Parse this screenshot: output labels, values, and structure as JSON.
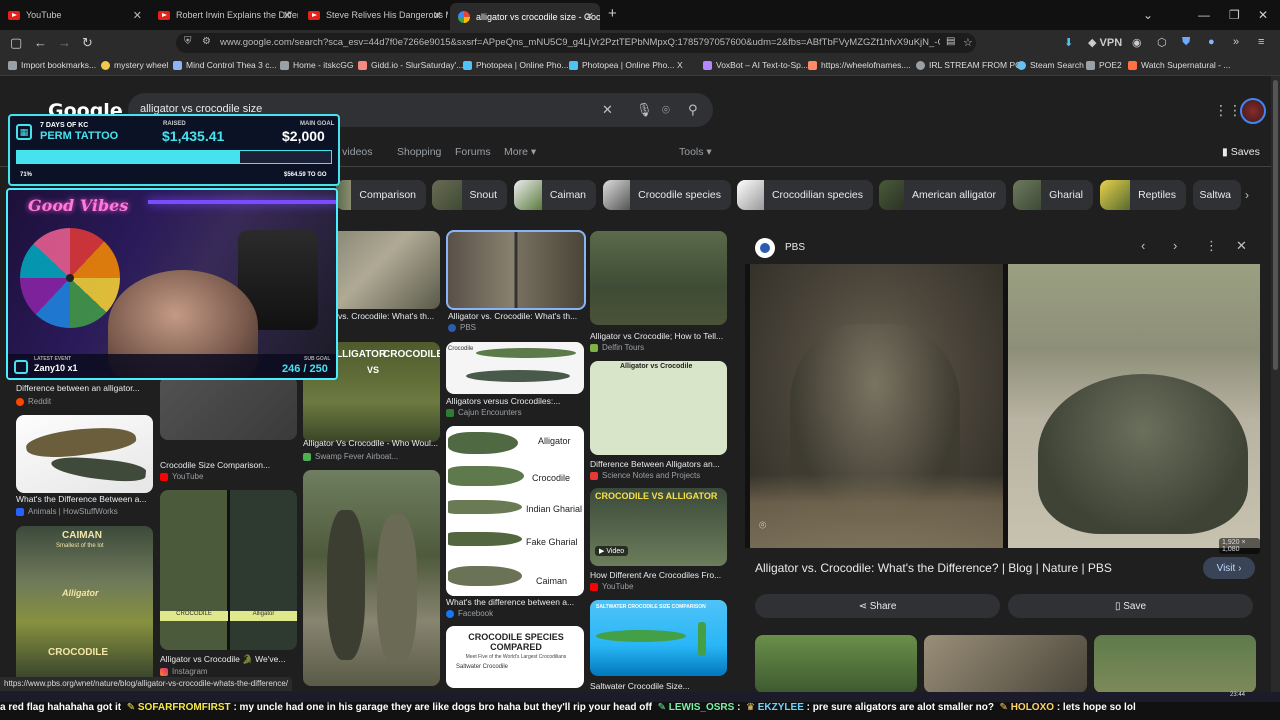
{
  "tabs": [
    {
      "title": "YouTube",
      "icon": "youtube-icon"
    },
    {
      "title": "Robert Irwin Explains the Differ",
      "icon": "youtube-icon"
    },
    {
      "title": "Steve Relives His Dangerous M",
      "icon": "youtube-icon"
    },
    {
      "title": "alligator vs crocodile size - Goo",
      "icon": "google-icon",
      "active": true
    }
  ],
  "address": {
    "url": "www.google.com/search?sca_esv=44d7f0e7266e9015&sxsrf=APpeQns_mNU5C9_g4LjVr2PztTEPbNMpxQ:1785797057600&udm=2&fbs=ABfTbFVyMZGZf1hfvX9uKjN_-G8c4u0n",
    "vpn_label": "VPN"
  },
  "bookmarks": [
    {
      "label": "Import bookmarks...",
      "color": "#9aa0a6"
    },
    {
      "label": "mystery wheel",
      "color": "#f2c94c"
    },
    {
      "label": "Mind Control Thea 3 c...",
      "color": "#8ab4f8"
    },
    {
      "label": "Home - itskcGG",
      "color": "#9aa0a6"
    },
    {
      "label": "Gidd.io - SlurSaturday'...",
      "color": "#f28b82"
    },
    {
      "label": "Photopea | Online Pho...",
      "color": "#4fc3f7"
    },
    {
      "label": "Photopea | Online Pho...",
      "color": "#4fc3f7"
    },
    {
      "label": "X",
      "color": "#ffffff"
    },
    {
      "label": "VoxBot – AI Text-to-Sp...",
      "color": "#b388ff"
    },
    {
      "label": "https://wheelofnames....",
      "color": "#ff8a65"
    },
    {
      "label": "IRL STREAM FROM PC",
      "color": "#9aa0a6"
    },
    {
      "label": "Steam Search",
      "color": "#66c0f4"
    },
    {
      "label": "POE2",
      "color": "#9aa0a6"
    },
    {
      "label": "Watch Supernatural - ...",
      "color": "#ff7043"
    }
  ],
  "google": {
    "logo": "Google",
    "query": "alligator vs crocodile size",
    "nav_tabs": [
      "ort videos",
      "Shopping",
      "Forums",
      "More ▾",
      "Tools ▾"
    ],
    "saves_label": "Saves"
  },
  "chips": [
    "Comparison",
    "Snout",
    "Caiman",
    "Crocodile species",
    "Crocodilian species",
    "American alligator",
    "Gharial",
    "Reptiles",
    "Saltwa"
  ],
  "results": [
    {
      "caption": "vs. Crocodile: What's th...",
      "source": ""
    },
    {
      "caption": "Alligator vs. Crocodile: What's th...",
      "source": "PBS"
    },
    {
      "caption": "Alligator vs Crocodile; How to Tell...",
      "source": "Delfin Tours"
    },
    {
      "caption": "Difference between an alligator...",
      "source": "Reddit"
    },
    {
      "caption": "Alligator Vs Crocodile - Who Woul...",
      "source": "Swamp Fever Airboat..."
    },
    {
      "caption": "Alligators versus Crocodiles:...",
      "source": "Cajun Encounters"
    },
    {
      "caption": "Crocodile Size Comparison...",
      "source": "YouTube"
    },
    {
      "caption": "Difference Between Alligators an...",
      "source": "Science Notes and Projects"
    },
    {
      "caption": "What's the Difference Between a...",
      "source": "Animals | HowStuffWorks"
    },
    {
      "caption": "What's the difference between a...",
      "source": "Facebook"
    },
    {
      "caption": "How Different Are Crocodiles Fro...",
      "source": "YouTube"
    },
    {
      "caption": "Alligator vs Crocodile 🐊 We've...",
      "source": "Instagram"
    },
    {
      "caption": "Saltwater Crocodile Size...",
      "source": ""
    }
  ],
  "image_text": {
    "alligator_croc_title": "ALLIGATOR VS CROCODILE",
    "croc_vs_alligator": "CROCODILE VS ALLIGATOR",
    "caiman": "CAIMAN",
    "caiman_sub": "Smallest of the lot",
    "alligator_label": "Alligator",
    "crocodile_label": "CROCODILE",
    "species_compared": "CROCODILE SPECIES COMPARED",
    "species_sub": "Meet Five of the World's Largest Crocodilians",
    "saltwater_crocodile": "Saltwater Crocodile",
    "side_labels": [
      "Alligator",
      "Crocodile",
      "Indian Gharial",
      "Fake Gharial",
      "Caiman"
    ],
    "video_badge": "Video",
    "saltwater_banner": "SALTWATER CROCODILE SIZE COMPARISON"
  },
  "panel": {
    "source": "PBS",
    "dimensions": "1,920 × 1,080",
    "title": "Alligator vs. Crocodile: What's the Difference? | Blog | Nature | PBS",
    "visit_label": "Visit",
    "share_label": "Share",
    "save_label": "Save"
  },
  "overlay": {
    "header": "7 DAYS OF KC",
    "subheader": "PERM TATTOO",
    "raised_label": "RAISED",
    "raised": "$1,435.41",
    "goal_label": "MAIN GOAL",
    "goal": "$2,000",
    "percent": "71%",
    "progress": 0.71,
    "remaining": "$564.59 TO GO",
    "neon": "Good Vibes",
    "latest_label": "LATEST EVENT",
    "latest_event": "Zany10 x1",
    "sub_goal_label": "SUB GOAL",
    "sub_goal": "246 / 250"
  },
  "status_url": "https://www.pbs.org/wnet/nature/blog/alligator-vs-crocodile-whats-the-difference/",
  "ticker": [
    {
      "text": "a red flag hahahaha got it",
      "color": "#ffffff"
    },
    {
      "text": "SOFARFROMFIRST",
      "color": "#f5e94b"
    },
    {
      "text": ": my uncle had one in his garage they are like dogs bro haha but they'll rip your head off",
      "color": "#ffffff"
    },
    {
      "text": "LEWIS_OSRS",
      "color": "#7cf0a4"
    },
    {
      "text": ":",
      "color": "#ffffff"
    },
    {
      "text": "EKZYLEE",
      "color": "#6fd3ff"
    },
    {
      "text": ": pre sure aligators are alot smaller no?",
      "color": "#ffffff"
    },
    {
      "text": "HOLOXO",
      "color": "#ffd166"
    },
    {
      "text": ": lets hope so lol",
      "color": "#ffffff"
    }
  ],
  "clock": "23:44",
  "colors": {
    "accent": "#8ab4f8",
    "overlay_cyan": "#46e3ee",
    "page_bg": "#1f1f1f"
  }
}
